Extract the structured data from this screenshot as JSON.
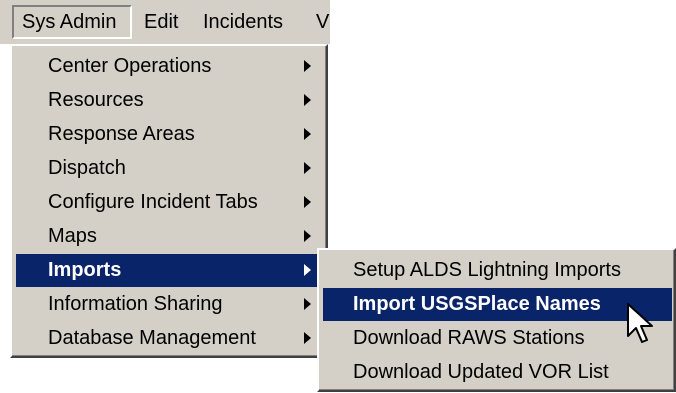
{
  "menubar": {
    "items": [
      {
        "label": "Sys Admin"
      },
      {
        "label": "Edit"
      },
      {
        "label": "Incidents"
      },
      {
        "label": "V"
      }
    ]
  },
  "sys_admin_menu": {
    "items": [
      {
        "label": "Center Operations"
      },
      {
        "label": "Resources"
      },
      {
        "label": "Response Areas"
      },
      {
        "label": "Dispatch"
      },
      {
        "label": "Configure Incident Tabs"
      },
      {
        "label": "Maps"
      },
      {
        "label": "Imports"
      },
      {
        "label": "Information Sharing"
      },
      {
        "label": "Database Management"
      }
    ],
    "selected": "Imports"
  },
  "imports_submenu": {
    "items": [
      {
        "label": "Setup ALDS Lightning Imports"
      },
      {
        "label": "Import USGSPlace Names"
      },
      {
        "label": "Download RAWS Stations"
      },
      {
        "label": "Download Updated VOR List"
      }
    ],
    "selected": "Import USGSPlace Names"
  },
  "colors": {
    "menu_bg": "#d4d0c8",
    "highlight": "#0a246a",
    "highlight_text": "#ffffff"
  },
  "icons": {
    "submenu_arrow": "triangle-right",
    "cursor": "arrow-pointer"
  }
}
